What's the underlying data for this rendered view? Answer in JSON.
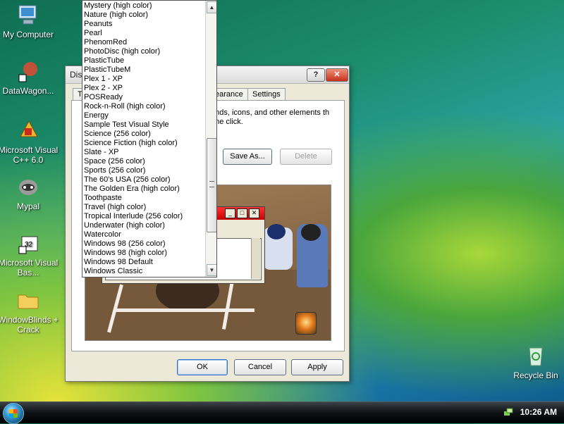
{
  "desktop": {
    "icons": [
      {
        "label": "My Computer"
      },
      {
        "label": "DataWagon..."
      },
      {
        "label": "Microsoft Visual C++ 6.0"
      },
      {
        "label": "Mypal"
      },
      {
        "label": "Microsoft Visual Bas..."
      },
      {
        "label": "WindowBlinds + Crack"
      },
      {
        "label": "Recycle Bin"
      }
    ]
  },
  "dialog": {
    "title": "Dis",
    "help_label": "?",
    "close_label": "✕",
    "tabs": [
      {
        "label": "T"
      },
      {
        "label": "earance"
      },
      {
        "label": "Settings"
      }
    ],
    "description": "unds, icons, and other elements th one click.",
    "save_as_label": "Save As...",
    "delete_label": "Delete",
    "ok_label": "OK",
    "cancel_label": "Cancel",
    "apply_label": "Apply"
  },
  "theme_list": [
    "Mystery (high color)",
    "Nature (high color)",
    "Peanuts",
    "Pearl",
    "PhenomRed",
    "PhotoDisc (high color)",
    "PlasticTube",
    "PlasticTubeM",
    "Plex 1 - XP",
    "Plex 2 - XP",
    "POSReady",
    "Rock-n-Roll (high color)",
    "Energy",
    "Sample Test Visual Style",
    "Science (256 color)",
    "Science Fiction (high color)",
    "Slate - XP",
    "Space (256 color)",
    "Sports (256 color)",
    "The 60's USA (256 color)",
    "The Golden Era (high color)",
    "Toothpaste",
    "Travel (high color)",
    "Tropical Interlude (256 color)",
    "Underwater (high color)",
    "Watercolor",
    "Windows 98 (256 color)",
    "Windows 98 (high color)",
    "Windows 98 Default",
    "Windows Classic"
  ],
  "taskbar": {
    "clock": "10:26 AM"
  },
  "colors": {
    "close_button": "#c8301a",
    "mini_titlebar": "#c80000",
    "default_button_border": "#3470c4"
  }
}
